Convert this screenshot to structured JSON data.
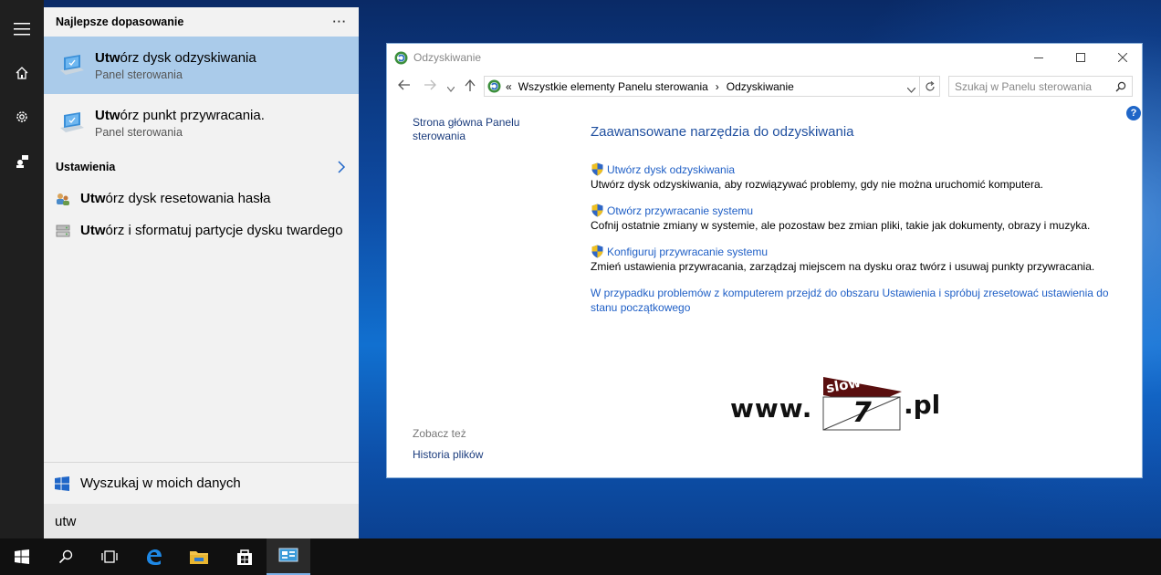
{
  "start_menu": {
    "rail": {
      "icons": [
        "hamburger-icon",
        "home-icon",
        "gear-icon",
        "user-feedback-icon"
      ]
    },
    "header": {
      "title": "Najlepsze dopasowanie",
      "more": "···"
    },
    "best_match": {
      "title_bold": "Utw",
      "title_rest": "órz dysk odzyskiwania",
      "subtitle": "Panel sterowania"
    },
    "apps": [
      {
        "title_bold": "Utw",
        "title_rest": "órz punkt przywracania.",
        "subtitle": "Panel sterowania"
      }
    ],
    "settings_header": "Ustawienia",
    "settings_items": [
      {
        "title_bold": "Utw",
        "title_rest": "órz dysk resetowania hasła"
      },
      {
        "title_bold": "Utw",
        "title_rest": "órz i sformatuj partycje dysku twardego"
      }
    ],
    "web_search_label": "Wyszukaj w moich danych",
    "query": "utw"
  },
  "window": {
    "title": "Odzyskiwanie",
    "address": {
      "chevrons": "«",
      "crumb1": "Wszystkie elementy Panelu sterowania",
      "separator": "›",
      "crumb2": "Odzyskiwanie"
    },
    "search_placeholder": "Szukaj w Panelu sterowania",
    "left_nav": {
      "home_link": "Strona główna Panelu sterowania"
    },
    "see_also_label": "Zobacz też",
    "history_link": "Historia plików",
    "heading": "Zaawansowane narzędzia do odzyskiwania",
    "tools": [
      {
        "link": "Utwórz dysk odzyskiwania",
        "desc": "Utwórz dysk odzyskiwania, aby rozwiązywać problemy, gdy nie można uruchomić komputera."
      },
      {
        "link": "Otwórz przywracanie systemu",
        "desc": "Cofnij ostatnie zmiany w systemie, ale pozostaw bez zmian pliki, takie jak dokumenty, obrazy i muzyka."
      },
      {
        "link": "Konfiguruj przywracanie systemu",
        "desc": "Zmień ustawienia przywracania, zarządzaj miejscem na dysku oraz twórz i usuwaj punkty przywracania."
      }
    ],
    "reset_link": "W przypadku problemów z komputerem przejdź do obszaru Ustawienia i spróbuj zresetować ustawienia do stanu początkowego",
    "help": "?"
  },
  "watermark": {
    "www": "www.",
    "slow": "slow",
    "seven": "7",
    "pl": ".pl"
  },
  "taskbar": {
    "icons": [
      "windows-start-icon",
      "search-icon",
      "task-view-icon",
      "edge-icon",
      "file-explorer-icon",
      "store-icon",
      "control-panel-icon"
    ]
  },
  "colors": {
    "highlight": "#aacbea",
    "link": "#1f5fc6",
    "taskbar": "#101010"
  }
}
